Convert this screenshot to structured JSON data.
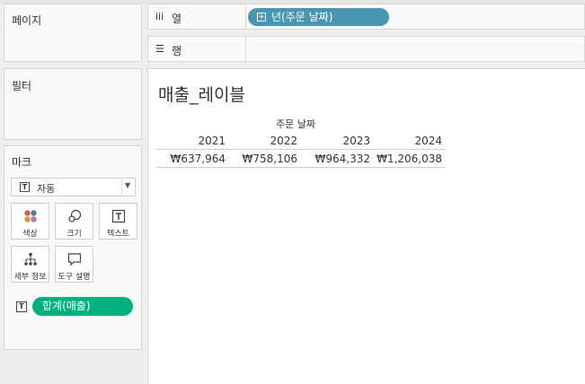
{
  "left": {
    "pages_title": "페이지",
    "filters_title": "필터",
    "marks_title": "마크",
    "mark_type": "자동",
    "mark_cards": [
      {
        "label": "색상",
        "icon": "color-icon"
      },
      {
        "label": "크기",
        "icon": "size-icon"
      },
      {
        "label": "텍스트",
        "icon": "text-icon"
      },
      {
        "label": "세부 정보",
        "icon": "detail-icon"
      },
      {
        "label": "도구 설명",
        "icon": "tooltip-icon"
      }
    ],
    "mark_pill": "합계(매출)"
  },
  "shelves": {
    "columns_label": "열",
    "rows_label": "행",
    "column_pill": "년(주문 날짜)"
  },
  "view": {
    "title": "매출_레이블",
    "column_header": "주문 날짜",
    "years": [
      "2021",
      "2022",
      "2023",
      "2024"
    ],
    "values": [
      "₩637,964",
      "₩758,106",
      "₩964,332",
      "₩1,206,038"
    ]
  },
  "colors": {
    "column_pill": "#4996b2",
    "measure_pill": "#00b180"
  }
}
